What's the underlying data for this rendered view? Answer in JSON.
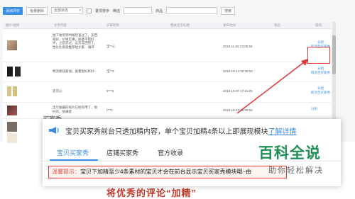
{
  "toolbar": {
    "primary_btn": "添加评价",
    "secondary_btn": "批量删除",
    "filter_select": "全部状态",
    "checkbox_label": "置顶排序",
    "search_label": "精选",
    "search_label2": "商品",
    "search_btn": "搜索"
  },
  "table": {
    "headers": [
      "图片/视频",
      "文字内容",
      "买家昵称",
      "相关宝贝标题",
      "发布时间",
      "状态",
      "操作"
    ],
    "rows": [
      {
        "text": "拍下收到到时候检查过了，东西很好，价格实惠，质量不错好评，之前买过，这次又回购了，性价比很高推荐给大家... 展开",
        "nick": "宝**心",
        "date": "2018-11-02 23:06:53",
        "ops": [
          "分组",
          "取消至买家秀"
        ]
      },
      {
        "text": "物流很快很快，质量很好好好~",
        "nick": "宝**2",
        "date": "2018-10-14 06:35:02",
        "ops": [
          "分组",
          "取消至买家秀"
        ]
      },
      {
        "text": "还可以",
        "nick": "5***5",
        "date": "2018-10-07 17:21:25",
        "ops": [
          "分组",
          "取消至买家秀"
        ]
      },
      {
        "text": "宝贝拍摄的照片已经有用了，很好的，很满意",
        "nick": "t***1",
        "date": "2018-10-07 18:08:55",
        "ops": [
          "分组"
        ]
      },
      {
        "text": "",
        "nick": "",
        "date": "",
        "ops": []
      }
    ]
  },
  "popup": {
    "notice_text": "宝贝买家秀前台只透加精内容，单个宝贝加精4条以上即展现模块",
    "notice_link": "了解详情",
    "tabs": [
      "宝贝买家秀",
      "店铺买家秀",
      "官方收录"
    ],
    "tip_prefix": "温馨提示：",
    "tip_body": "宝贝下加精至少4条素材的宝贝才会在前台显示宝贝买家秀模块哦~由"
  },
  "side_text": "买家秀",
  "caption": "将优秀的评论“加精”",
  "watermark": {
    "big": "百科全说",
    "small": "助你轻松解决"
  },
  "colors": {
    "accent": "#3a8ee6",
    "highlight": "#e03a3a",
    "watermark": "#1f8f55"
  }
}
